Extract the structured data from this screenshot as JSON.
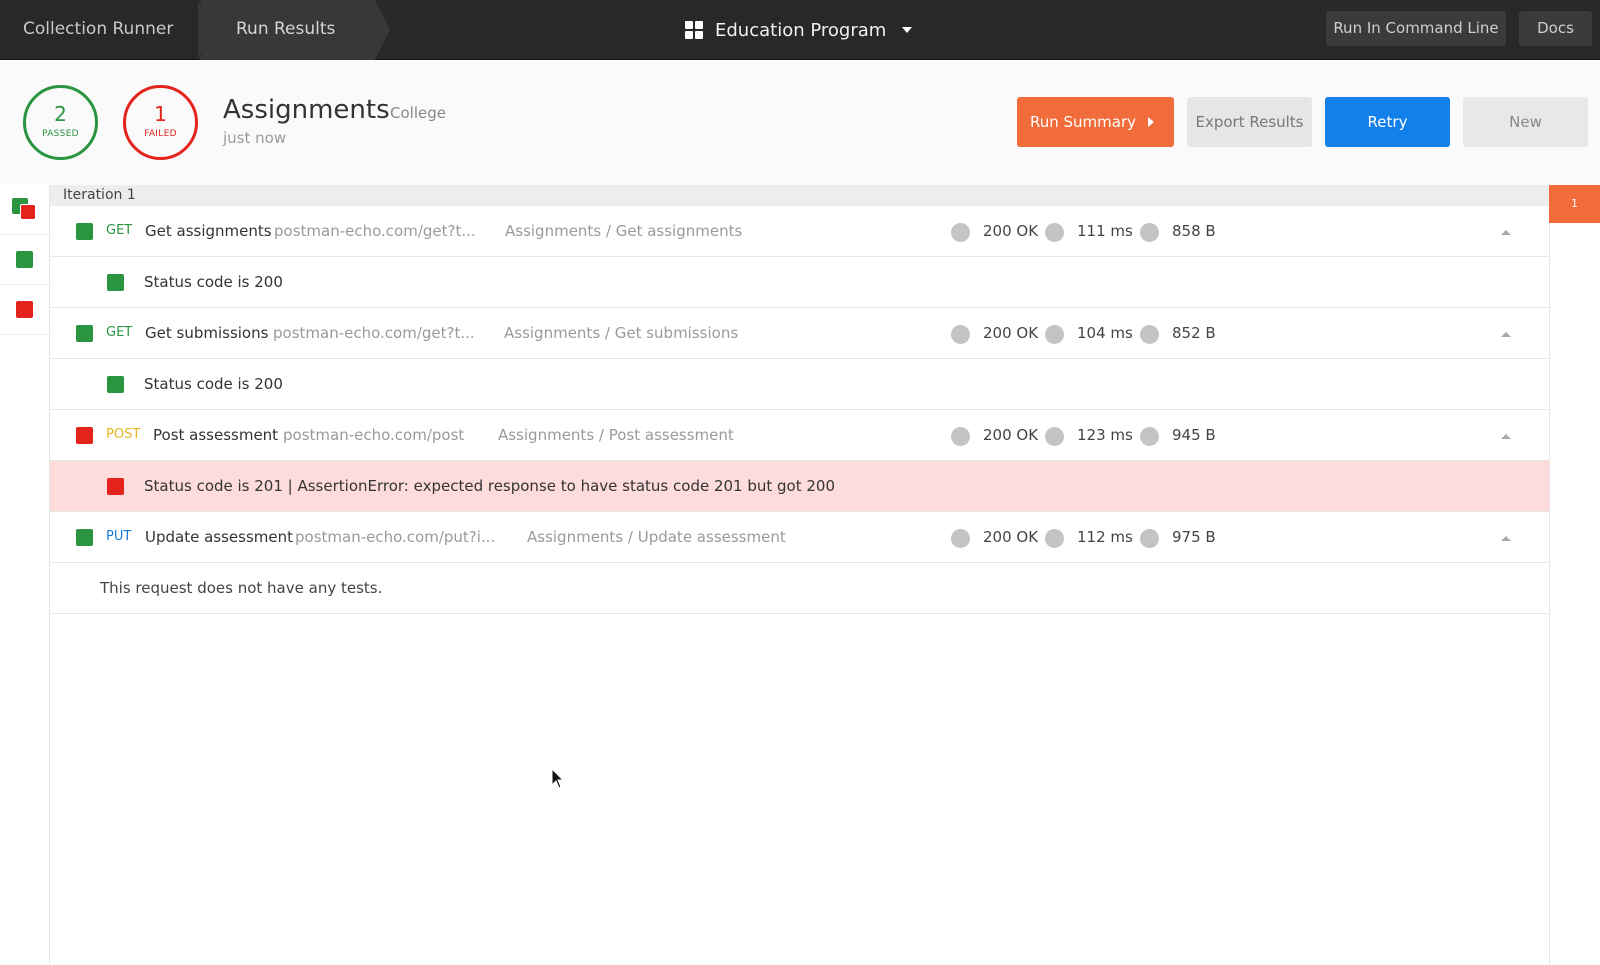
{
  "topbar": {
    "crumb_runner": "Collection Runner",
    "crumb_results": "Run Results",
    "workspace": "Education Program",
    "cli_label": "Run In Command Line",
    "docs_label": "Docs"
  },
  "summary": {
    "passed_count": "2",
    "passed_label": "PASSED",
    "failed_count": "1",
    "failed_label": "FAILED",
    "title": "Assignments",
    "environment": "College",
    "time": "just now"
  },
  "actions": {
    "run_summary": "Run Summary",
    "export": "Export Results",
    "retry": "Retry",
    "new": "New"
  },
  "iteration": {
    "label": "Iteration 1",
    "badge": "1"
  },
  "requests": [
    {
      "method": "GET",
      "name": "Get assignments",
      "url": "postman-echo.com/get?t...",
      "path": "Assignments / Get assignments",
      "status": "200 OK",
      "time": "111 ms",
      "size": "858 B",
      "test": "Status code is 200"
    },
    {
      "method": "GET",
      "name": "Get submissions",
      "url": "postman-echo.com/get?t...",
      "path": "Assignments / Get submissions",
      "status": "200 OK",
      "time": "104 ms",
      "size": "852 B",
      "test": "Status code is 200"
    },
    {
      "method": "POST",
      "name": "Post assessment",
      "url": "postman-echo.com/post",
      "path": "Assignments / Post assessment",
      "status": "200 OK",
      "time": "123 ms",
      "size": "945 B",
      "test": "Status code is 201 | AssertionError: expected response to have status code 201 but got 200"
    },
    {
      "method": "PUT",
      "name": "Update assessment",
      "url": "postman-echo.com/put?i...",
      "path": "Assignments / Update assessment",
      "status": "200 OK",
      "time": "112 ms",
      "size": "975 B",
      "test": "This request does not have any tests."
    }
  ],
  "colors": {
    "pass": "#2a9440",
    "fail": "#e3231c",
    "accent_orange": "#f26b3a",
    "accent_blue": "#1280eb"
  }
}
